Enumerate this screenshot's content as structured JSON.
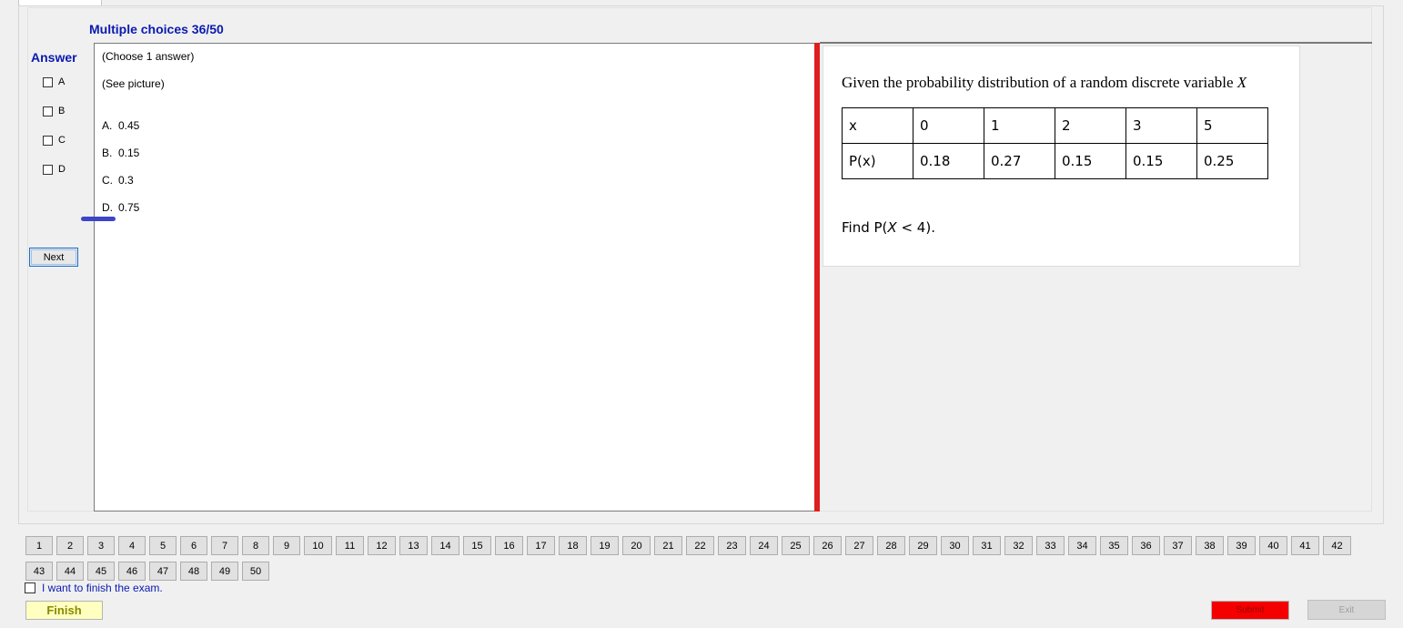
{
  "header": {
    "title": "Multiple choices 36/50"
  },
  "answer_panel": {
    "label": "Answer",
    "options": [
      "A",
      "B",
      "C",
      "D"
    ],
    "next_label": "Next"
  },
  "question": {
    "instruction": "(Choose 1 answer)",
    "hint": "(See picture)",
    "options": [
      {
        "key": "A.",
        "value": "0.45"
      },
      {
        "key": "B.",
        "value": "0.15"
      },
      {
        "key": "C.",
        "value": "0.3"
      },
      {
        "key": "D.",
        "value": "0.75"
      }
    ]
  },
  "picture": {
    "intro": "Given the probability distribution of a random discrete variable ",
    "variable": "X",
    "table": {
      "row1": [
        "x",
        "0",
        "1",
        "2",
        "3",
        "5"
      ],
      "row2": [
        "P(x)",
        "0.18",
        "0.27",
        "0.15",
        "0.15",
        "0.25"
      ]
    },
    "question_prefix": "Find P(",
    "question_var": "X",
    "question_suffix": " < 4)."
  },
  "navigation": {
    "questions": [
      "1",
      "2",
      "3",
      "4",
      "5",
      "6",
      "7",
      "8",
      "9",
      "10",
      "11",
      "12",
      "13",
      "14",
      "15",
      "16",
      "17",
      "18",
      "19",
      "20",
      "21",
      "22",
      "23",
      "24",
      "25",
      "26",
      "27",
      "28",
      "29",
      "30",
      "31",
      "32",
      "33",
      "34",
      "35",
      "36",
      "37",
      "38",
      "39",
      "40",
      "41",
      "42",
      "43",
      "44",
      "45",
      "46",
      "47",
      "48",
      "49",
      "50"
    ]
  },
  "footer": {
    "finish_check_label": "I want to finish the exam.",
    "finish_label": "Finish",
    "submit_label": "Submit",
    "exit_label": "Exit"
  },
  "colors": {
    "title_blue": "#0a1ab0",
    "divider_red": "#dd1f1f",
    "submit_red": "#f40000",
    "finish_yellow": "#ffffc0"
  }
}
